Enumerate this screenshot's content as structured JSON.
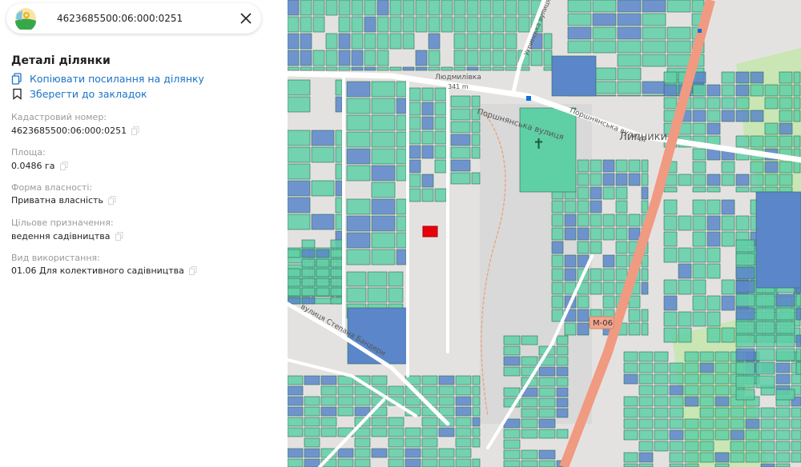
{
  "search": {
    "value": "4623685500:06:000:0251",
    "logo_icon": "map-pin-logo-icon",
    "close_icon": "close-icon"
  },
  "details": {
    "title": "Деталі ділянки",
    "copy_link_label": "Копіювати посилання на ділянку",
    "bookmark_label": "Зберегти до закладок",
    "fields": [
      {
        "label": "Кадастровий номер:",
        "value": "4623685500:06:000:0251"
      },
      {
        "label": "Площа:",
        "value": "0.0486 га"
      },
      {
        "label": "Форма власності:",
        "value": "Приватна власність"
      },
      {
        "label": "Цільове призначення:",
        "value": "ведення садівництва"
      },
      {
        "label": "Вид використання:",
        "value": "01.06 Для колективного садівництва"
      }
    ]
  },
  "map": {
    "labels": {
      "street1": "Поршнянська вулиця",
      "street2": "Поршнянська вулиця",
      "street3": "Угринська вулиця",
      "street4": "вулиця Степана Бандери",
      "village": "Липники",
      "road": "М-06",
      "place": "Людмилівка",
      "elevation": "341 m"
    },
    "colors": {
      "private": "#5fcfa6",
      "state": "#5b86c9",
      "selected": "#e8000b",
      "highway": "#f4977f",
      "park": "#c9e6b4"
    }
  }
}
